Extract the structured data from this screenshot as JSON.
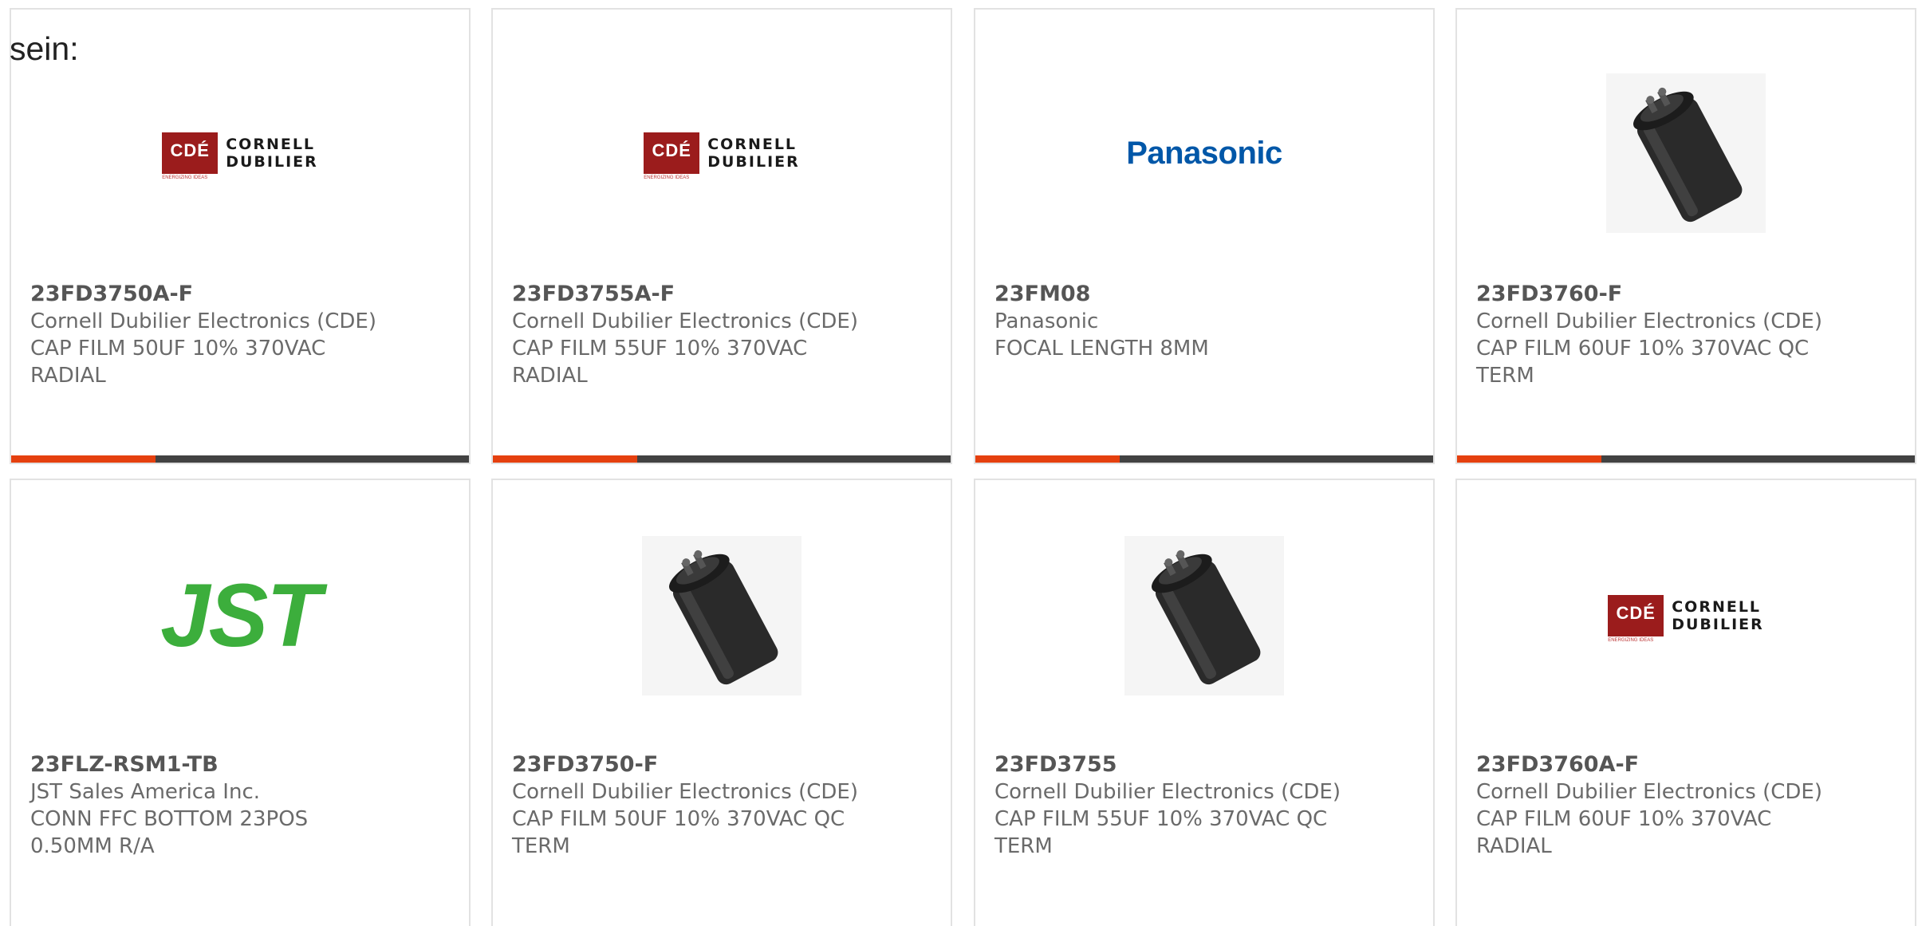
{
  "heading": "sein:",
  "products": [
    {
      "part_number": "23FD3750A-F",
      "manufacturer": "Cornell Dubilier Electronics (CDE)",
      "description": "CAP FILM 50UF 10% 370VAC RADIAL",
      "image": "cde-logo"
    },
    {
      "part_number": "23FD3755A-F",
      "manufacturer": "Cornell Dubilier Electronics (CDE)",
      "description": "CAP FILM 55UF 10% 370VAC RADIAL",
      "image": "cde-logo"
    },
    {
      "part_number": "23FM08",
      "manufacturer": "Panasonic",
      "description": "FOCAL LENGTH 8MM",
      "image": "panasonic-logo"
    },
    {
      "part_number": "23FD3760-F",
      "manufacturer": "Cornell Dubilier Electronics (CDE)",
      "description": "CAP FILM 60UF 10% 370VAC QC TERM",
      "image": "capacitor-photo"
    },
    {
      "part_number": "23FLZ-RSM1-TB",
      "manufacturer": "JST Sales America Inc.",
      "description": "CONN FFC BOTTOM 23POS 0.50MM R/A",
      "image": "jst-logo"
    },
    {
      "part_number": "23FD3750-F",
      "manufacturer": "Cornell Dubilier Electronics (CDE)",
      "description": "CAP FILM 50UF 10% 370VAC QC TERM",
      "image": "capacitor-photo"
    },
    {
      "part_number": "23FD3755",
      "manufacturer": "Cornell Dubilier Electronics (CDE)",
      "description": "CAP FILM 55UF 10% 370VAC QC TERM",
      "image": "capacitor-photo"
    },
    {
      "part_number": "23FD3760A-F",
      "manufacturer": "Cornell Dubilier Electronics (CDE)",
      "description": "CAP FILM 60UF 10% 370VAC RADIAL",
      "image": "cde-logo"
    }
  ],
  "logos": {
    "cde_mark": "CDÉ",
    "cde_line1": "CORNELL",
    "cde_line2": "DUBILIER",
    "cde_tagline": "ENERGIZING IDEAS",
    "panasonic": "Panasonic",
    "jst": "JST"
  },
  "colors": {
    "accent": "#e5400f",
    "bar": "#424242",
    "cde_red": "#9b1c1c",
    "panasonic_blue": "#0057a8",
    "jst_green": "#3cae3c"
  }
}
